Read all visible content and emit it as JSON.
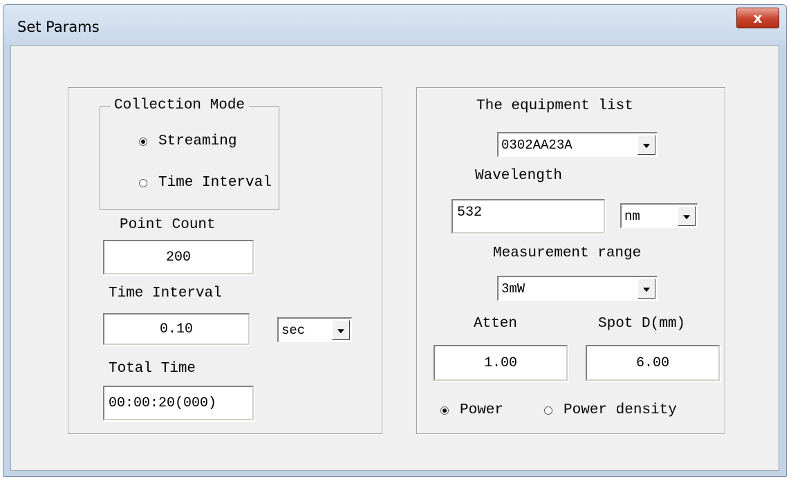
{
  "window": {
    "title": "Set Params",
    "close_label": "x"
  },
  "left_panel": {
    "collection_mode": {
      "label": "Collection Mode",
      "options": [
        {
          "label": "Streaming",
          "selected": true
        },
        {
          "label": "Time Interval",
          "selected": false
        }
      ]
    },
    "point_count": {
      "label": "Point Count",
      "value": "200"
    },
    "time_interval": {
      "label": "Time Interval",
      "value": "0.10",
      "unit": "sec"
    },
    "total_time": {
      "label": "Total Time",
      "value": "00:00:20(000)"
    }
  },
  "right_panel": {
    "equipment_list": {
      "label": "The equipment list",
      "value": "0302AA23A"
    },
    "wavelength": {
      "label": "Wavelength",
      "value": "532",
      "unit": "nm"
    },
    "measurement_range": {
      "label": "Measurement range",
      "value": "3mW"
    },
    "atten": {
      "label": "Atten",
      "value": "1.00"
    },
    "spot_d": {
      "label": "Spot D(mm)",
      "value": "6.00"
    },
    "mode_options": [
      {
        "label": "Power",
        "selected": true
      },
      {
        "label": "Power density",
        "selected": false
      }
    ]
  }
}
